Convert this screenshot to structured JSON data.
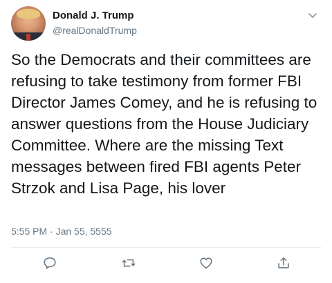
{
  "author": {
    "display_name": "Donald J. Trump",
    "handle": "@realDonaldTrump",
    "avatar_icon": "profile-photo"
  },
  "tweet": {
    "text": "So the Democrats and their committees are refusing to take testimony from former FBI Director James Comey, and he is refusing to answer questions from the House Judiciary Committee. Where are the missing Text messages between fired FBI agents Peter Strzok and Lisa Page, his lover",
    "timestamp": "5:55 PM · Jan 55, 5555"
  },
  "actions": {
    "reply_icon": "comment-icon",
    "retweet_icon": "retweet-icon",
    "like_icon": "heart-icon",
    "share_icon": "share-icon"
  },
  "colors": {
    "text": "#14171a",
    "secondary": "#657786",
    "icon": "#657786",
    "divider": "#e6ecf0"
  }
}
